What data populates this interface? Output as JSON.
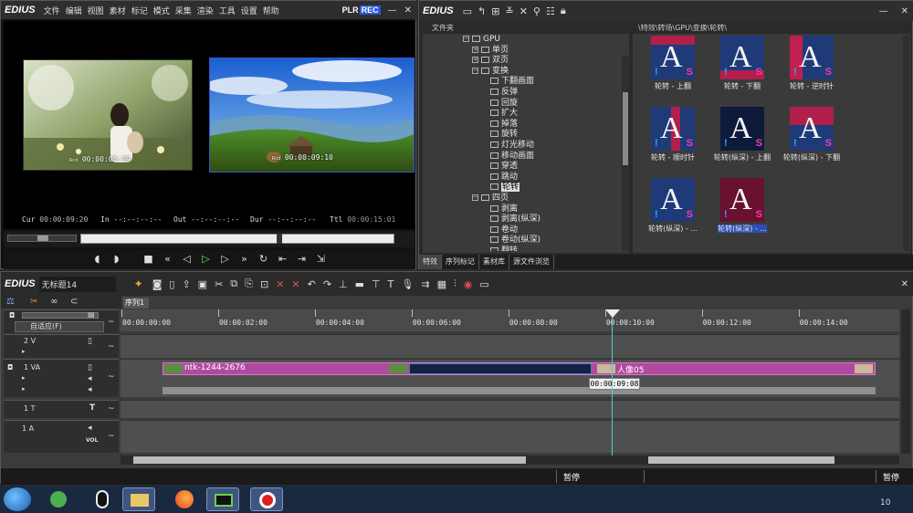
{
  "player": {
    "brand": "EDIUS",
    "menu": [
      "文件",
      "编辑",
      "视图",
      "素材",
      "标记",
      "模式",
      "采集",
      "渲染",
      "工具",
      "设置",
      "帮助"
    ],
    "plr": "PLR",
    "rec": "REC",
    "source_tc": "00:00:05:19",
    "record_tc": "00:00:09:10",
    "tc_prefix": "Rcd",
    "cur_label": "Cur",
    "cur": "00:00:09:20",
    "in_label": "In",
    "in": "--:--:--:--",
    "out_label": "Out",
    "out": "--:--:--:--",
    "dur_label": "Dur",
    "dur": "--:--:--:--",
    "ttl_label": "Ttl",
    "ttl": "00:00:15:01"
  },
  "bin": {
    "brand": "EDIUS",
    "folder_title": "文件夹",
    "path": "\\特效\\转场\\GPU\\变换\\轮转\\",
    "tree": [
      {
        "label": "GPU",
        "expand": "−",
        "indent": 0
      },
      {
        "label": "单页",
        "expand": "+",
        "indent": 1
      },
      {
        "label": "双页",
        "expand": "+",
        "indent": 1
      },
      {
        "label": "变换",
        "expand": "−",
        "indent": 1
      },
      {
        "label": "下翻画面",
        "expand": "",
        "indent": 2
      },
      {
        "label": "反弹",
        "expand": "",
        "indent": 2
      },
      {
        "label": "回旋",
        "expand": "",
        "indent": 2
      },
      {
        "label": "扩大",
        "expand": "",
        "indent": 2
      },
      {
        "label": "掉落",
        "expand": "",
        "indent": 2
      },
      {
        "label": "旋转",
        "expand": "",
        "indent": 2
      },
      {
        "label": "灯光移动",
        "expand": "",
        "indent": 2
      },
      {
        "label": "移动画面",
        "expand": "",
        "indent": 2
      },
      {
        "label": "穿透",
        "expand": "",
        "indent": 2
      },
      {
        "label": "跳动",
        "expand": "",
        "indent": 2
      },
      {
        "label": "轮转",
        "expand": "",
        "indent": 2,
        "selected": true
      },
      {
        "label": "四页",
        "expand": "−",
        "indent": 1
      },
      {
        "label": "剥离",
        "expand": "",
        "indent": 2
      },
      {
        "label": "剥离(纵深)",
        "expand": "",
        "indent": 2
      },
      {
        "label": "卷动",
        "expand": "",
        "indent": 2
      },
      {
        "label": "卷动(纵深)",
        "expand": "",
        "indent": 2
      },
      {
        "label": "翻转",
        "expand": "",
        "indent": 2
      }
    ],
    "effects": [
      {
        "label": "轮转 - 上翻",
        "variant": "up"
      },
      {
        "label": "轮转 - 下翻",
        "variant": "down"
      },
      {
        "label": "轮转 - 逆时针",
        "variant": "ccw"
      },
      {
        "label": "轮转 - 顺时针",
        "variant": "cw"
      },
      {
        "label": "轮转(纵深) - 上翻",
        "variant": "dup"
      },
      {
        "label": "轮转(纵深) - 下翻",
        "variant": "ddown"
      },
      {
        "label": "轮转(纵深) - ...",
        "variant": "d3"
      },
      {
        "label": "轮转(纵深) - ...",
        "variant": "d4",
        "selected": true
      }
    ],
    "tabs": [
      "特效",
      "序列标记",
      "素材库",
      "源文件浏览"
    ]
  },
  "timeline": {
    "brand": "EDIUS",
    "project": "无标题14",
    "sequence_tab": "序列1",
    "mode": "自适应(F)",
    "ruler_labels": [
      "00:00:00:00",
      "00:00:02:00",
      "00:00:04:00",
      "00:00:06:00",
      "00:00:08:00",
      "00:00:10:00",
      "00:00:12:00",
      "00:00:14:00"
    ],
    "tracks": {
      "v2": "2 V",
      "va1": "1 VA",
      "t1": "1 T",
      "a1": "1 A",
      "vol": "VOL"
    },
    "clip1_name": "ntk-1244-2676",
    "clip2_name": "人像05",
    "tooltip": "00:00:09:08",
    "status_left": "暂停",
    "status_right": "暂停"
  },
  "taskbar": {
    "clock": "10"
  },
  "colors": {
    "clip": "#b04aa0",
    "playhead": "#4ad0d0",
    "rec": "#2a58d8",
    "selection": "#2c4fb3"
  }
}
